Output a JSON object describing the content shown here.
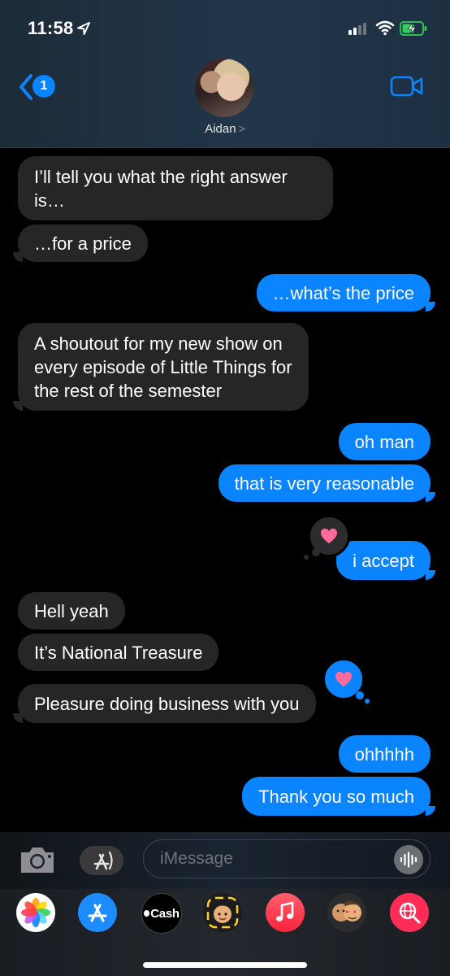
{
  "status_bar": {
    "time": "11:58"
  },
  "header": {
    "back_badge_count": "1",
    "contact_name": "Aidan",
    "contact_chevron": ">"
  },
  "messages": [
    {
      "side": "in",
      "text": "I’ll tell you what the right answer\nis…"
    },
    {
      "side": "in",
      "text": "…for a price"
    },
    {
      "side": "out",
      "text": "…what’s the price"
    },
    {
      "side": "in",
      "text": "A shoutout for my new show on\nevery episode of Little Things for\nthe rest of the semester"
    },
    {
      "side": "out",
      "text": "oh man"
    },
    {
      "side": "out",
      "text": "that is very reasonable"
    },
    {
      "side": "out",
      "text": "i accept",
      "tapback": "heart"
    },
    {
      "side": "in",
      "text": "Hell yeah"
    },
    {
      "side": "in",
      "text": "It’s National Treasure"
    },
    {
      "side": "in",
      "text": "Pleasure doing business with you",
      "tapback": "heart"
    },
    {
      "side": "out",
      "text": "ohhhhh"
    },
    {
      "side": "out",
      "text": "Thank you so much"
    }
  ],
  "composer": {
    "placeholder": "iMessage"
  },
  "app_drawer": [
    {
      "name": "photos-app-icon"
    },
    {
      "name": "app-store-icon"
    },
    {
      "name": "apple-cash-icon",
      "label": "Cash",
      "prefix": ""
    },
    {
      "name": "memoji-app-icon"
    },
    {
      "name": "music-app-icon"
    },
    {
      "name": "memoji-stickers-icon"
    },
    {
      "name": "web-search-icon"
    }
  ],
  "colors": {
    "incoming_bubble": "#262628",
    "outgoing_bubble": "#0a84ff",
    "tapback_heart": "#ff6b9a",
    "background": "#000000"
  }
}
